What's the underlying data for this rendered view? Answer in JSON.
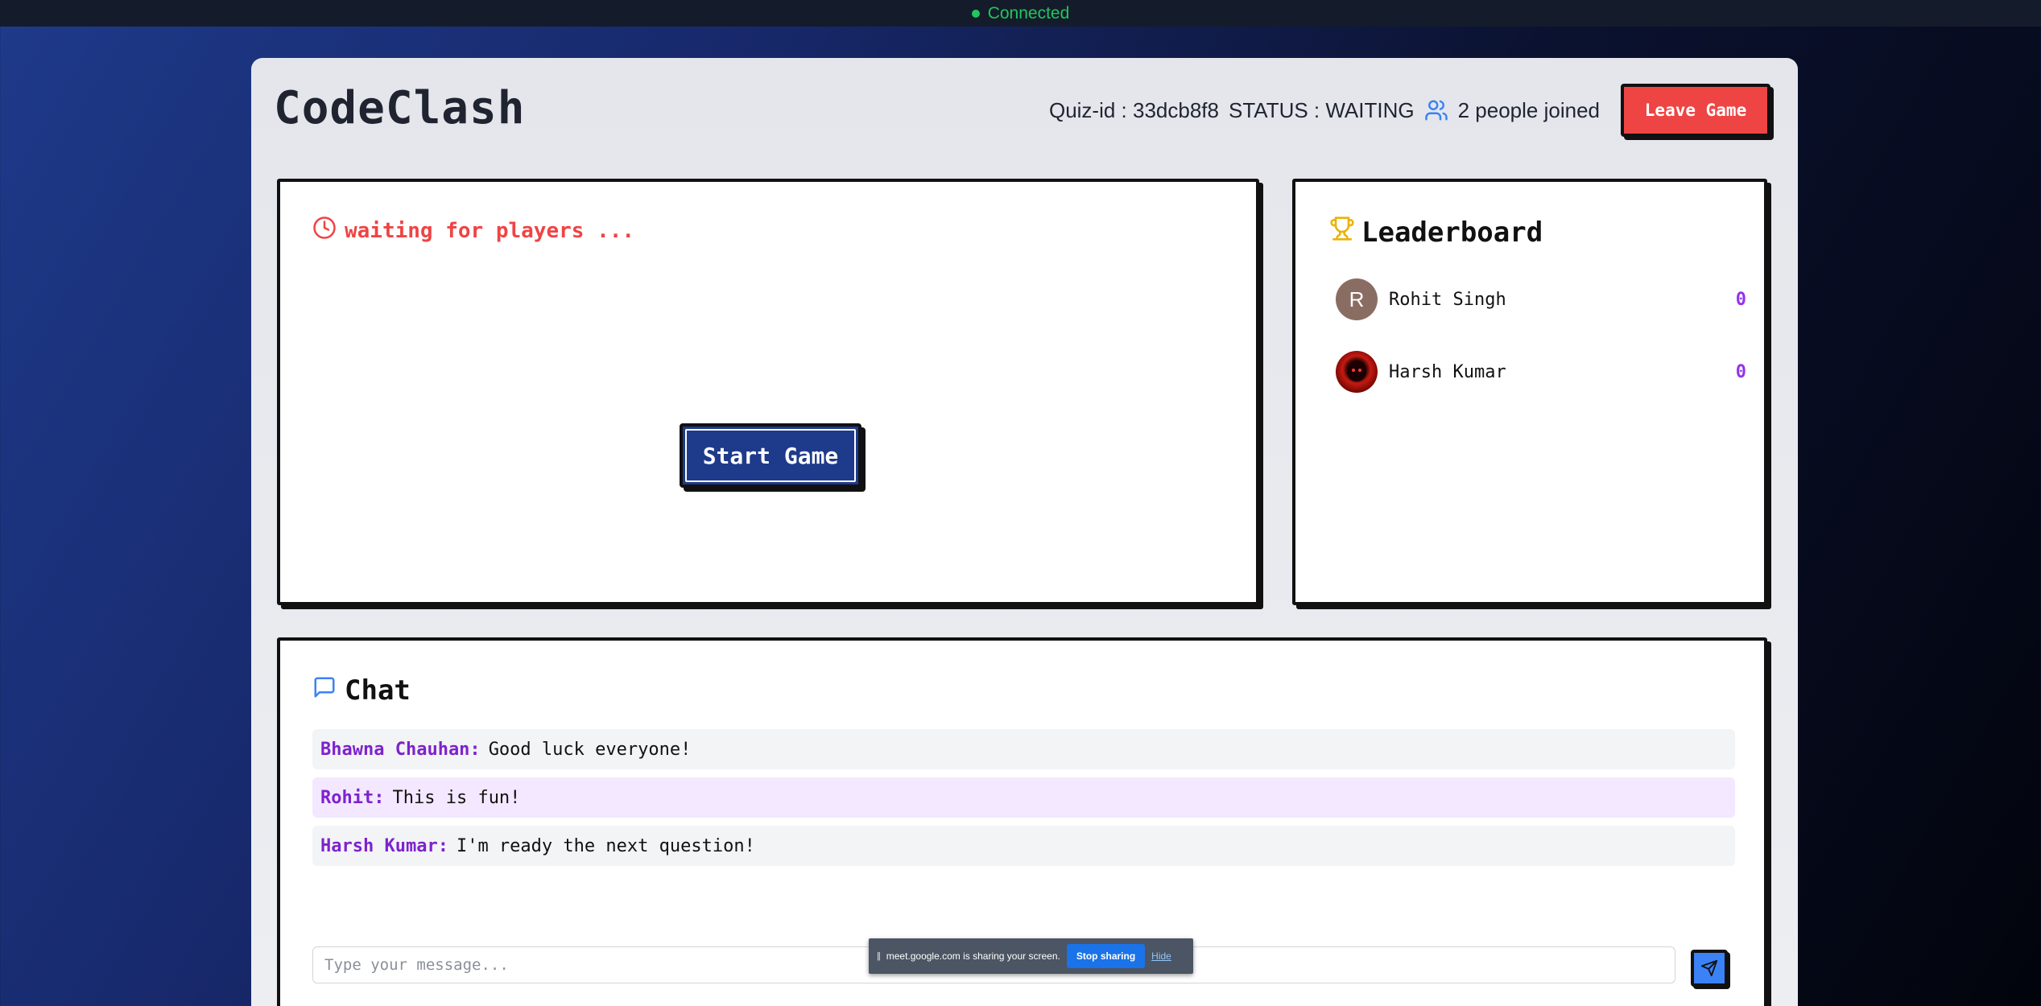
{
  "status_bar": {
    "label": "Connected",
    "color": "#22c55e"
  },
  "app": {
    "title": "CodeClash"
  },
  "header": {
    "quiz_id": "Quiz-id : 33dcb8f8",
    "status": "STATUS : WAITING",
    "joined": "2 people joined",
    "leave_label": "Leave Game"
  },
  "game": {
    "waiting_text": "waiting for players ...",
    "start_label": "Start Game"
  },
  "leaderboard": {
    "title": "Leaderboard",
    "players": [
      {
        "initial": "R",
        "name": "Rohit Singh",
        "score": "0"
      },
      {
        "initial": "",
        "name": "Harsh Kumar",
        "score": "0"
      }
    ]
  },
  "chat": {
    "title": "Chat",
    "messages": [
      {
        "sender": "Bhawna Chauhan:",
        "text": "Good luck everyone!"
      },
      {
        "sender": "Rohit:",
        "text": "This is fun!"
      },
      {
        "sender": "Harsh Kumar:",
        "text": "I'm ready the next question!"
      }
    ],
    "input_placeholder": "Type your message..."
  },
  "share_notice": {
    "pause_glyph": "||",
    "text": "meet.google.com is sharing your screen.",
    "stop_label": "Stop sharing",
    "hide_label": "Hide"
  },
  "colors": {
    "accent_blue": "#1e3a8a",
    "danger_red": "#ef4444",
    "score_purple": "#9333ea"
  }
}
